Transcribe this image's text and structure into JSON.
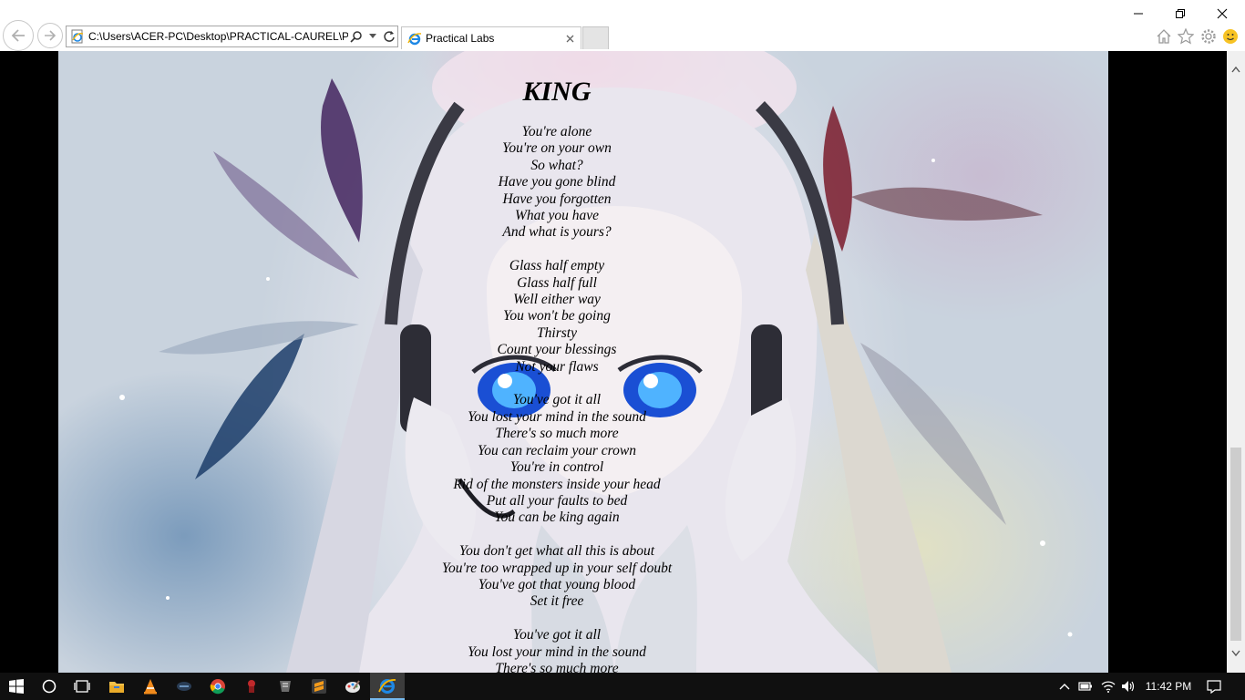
{
  "browser": {
    "address": "C:\\Users\\ACER-PC\\Desktop\\PRACTICAL-CAUREL\\Prac",
    "tab_title": "Practical Labs"
  },
  "poem": {
    "title": "KING",
    "stanzas": [
      [
        "You're alone",
        "You're on your own",
        "So what?",
        "Have you gone blind",
        "Have you forgotten",
        "What you have",
        "And what is yours?"
      ],
      [
        "Glass half empty",
        "Glass half full",
        "Well either way",
        "You won't be going",
        "Thirsty",
        "Count your blessings",
        "Not your flaws"
      ],
      [
        "You've got it all",
        "You lost your mind in the sound",
        "There's so much more",
        "You can reclaim your crown",
        "You're in control",
        "Rid of the monsters inside your head",
        "Put all your faults to bed",
        "You can be king again"
      ],
      [
        "You don't get what all this is about",
        "You're too wrapped up in your self doubt",
        "You've got that young blood",
        "Set it free"
      ],
      [
        "You've got it all",
        "You lost your mind in the sound",
        "There's so much more"
      ]
    ]
  },
  "taskbar": {
    "clock": "11:42 PM",
    "apps": [
      "start-icon",
      "search-icon",
      "task-view-icon",
      "file-explorer-icon",
      "vlc-icon",
      "app-icon",
      "chrome-icon",
      "app-icon",
      "app-icon",
      "sublime-text-icon",
      "paint-icon",
      "internet-explorer-icon"
    ]
  },
  "colors": {
    "chrome_bg": "#ffffff",
    "taskbar_bg": "#101010",
    "ie_blue": "#1e88e5"
  }
}
